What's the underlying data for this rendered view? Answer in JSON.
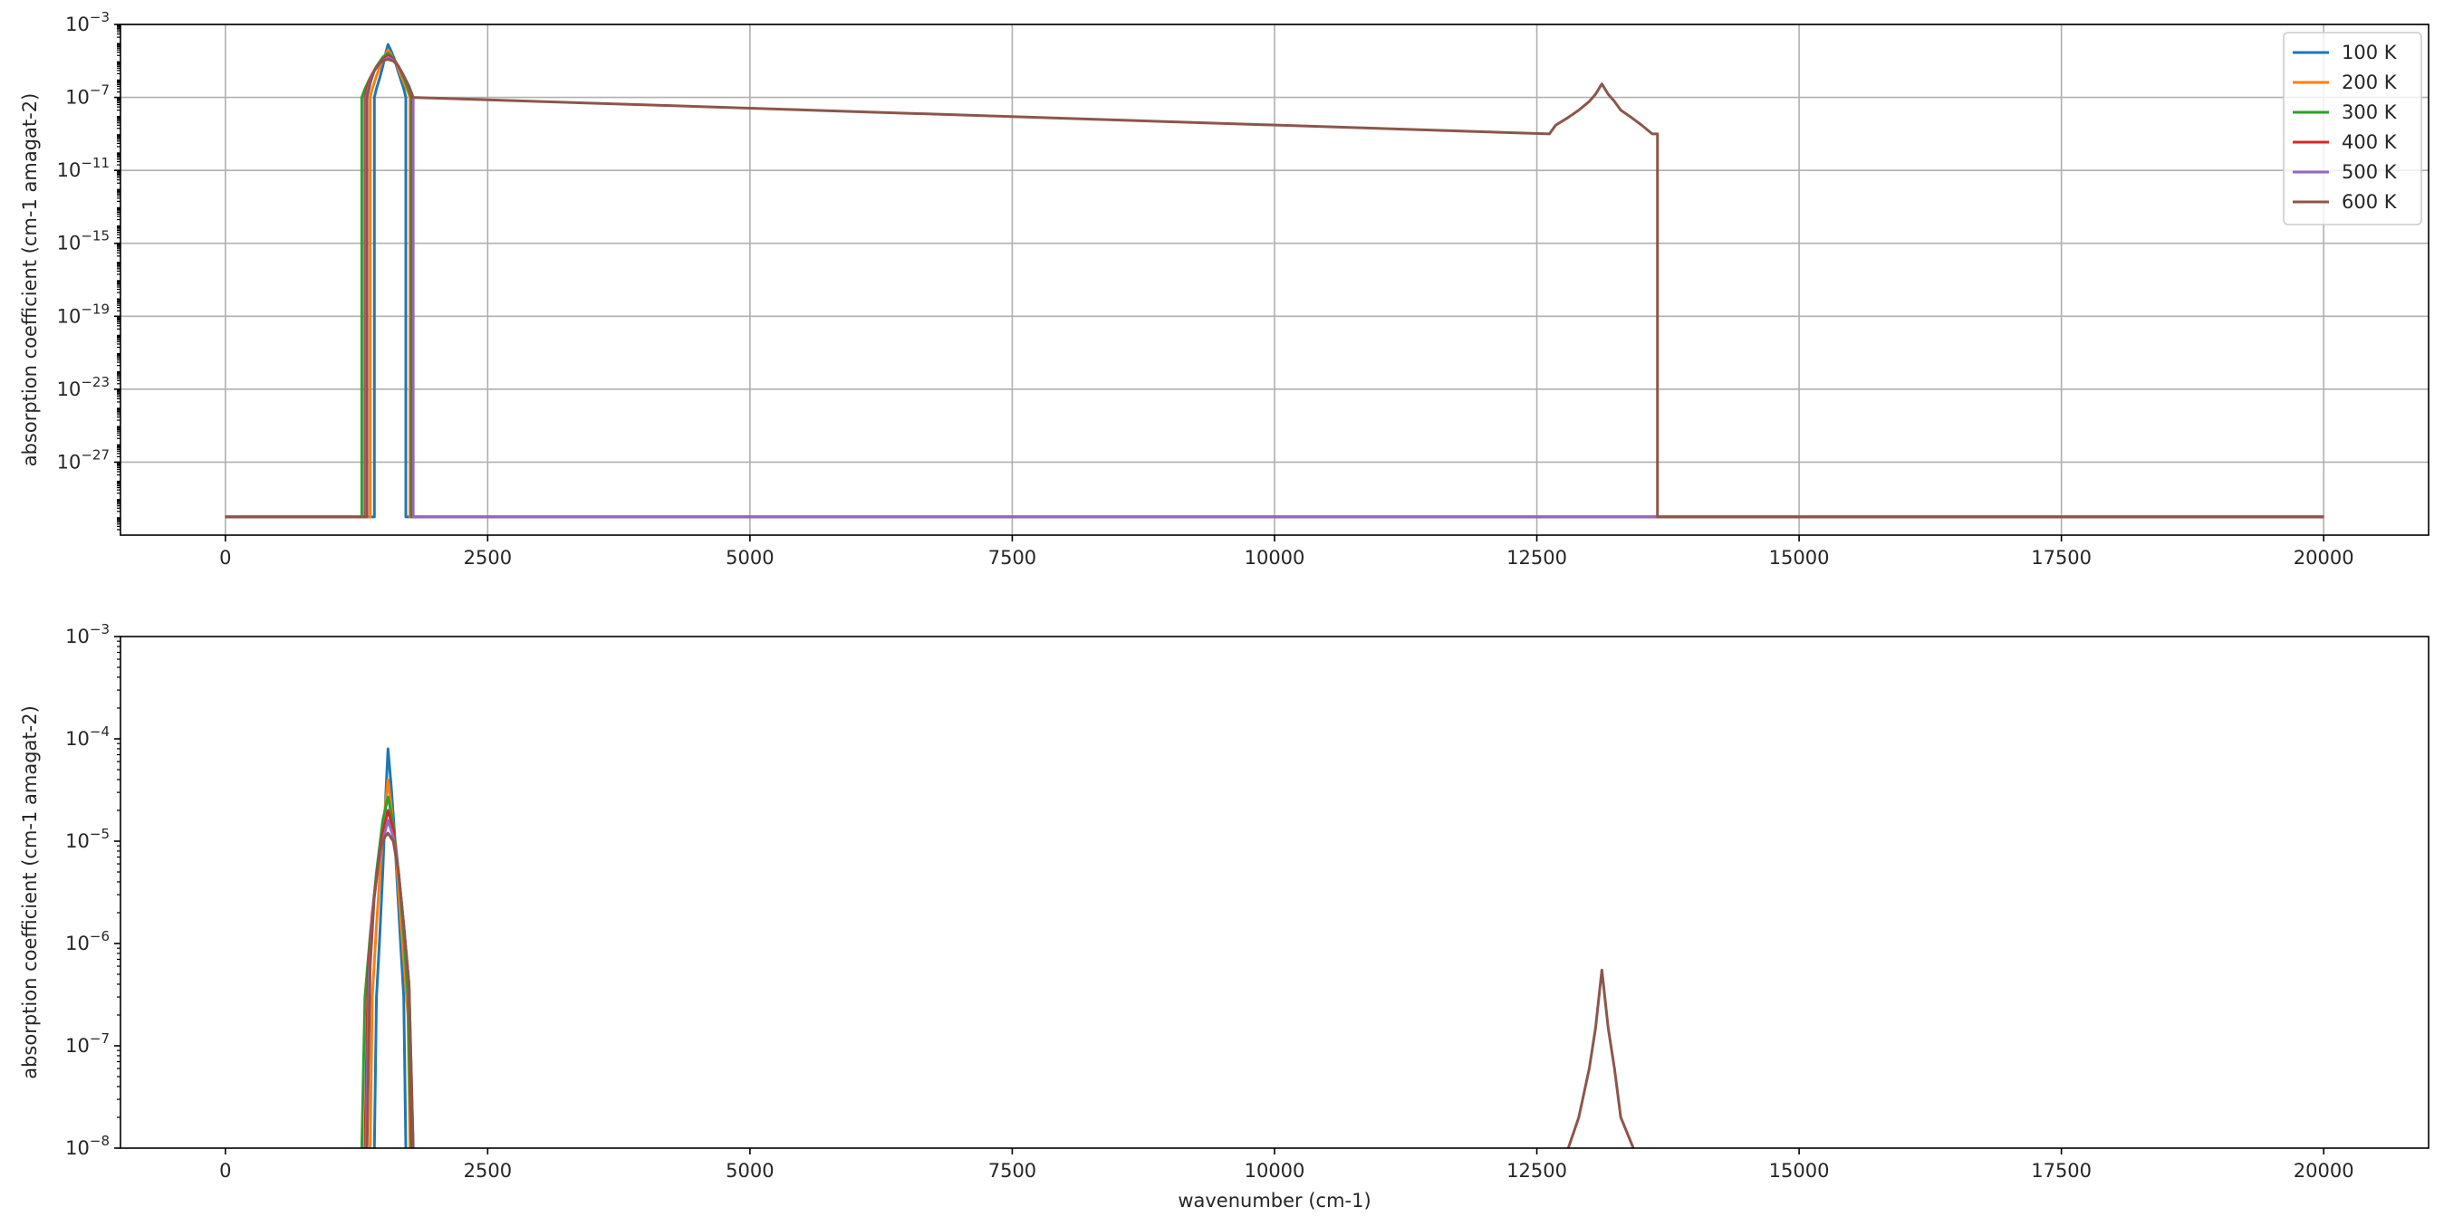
{
  "chart_data": [
    {
      "type": "line",
      "title": "",
      "xlabel": "",
      "ylabel": "absorption coefficient (cm-1 amagat-2)",
      "yscale": "log",
      "xlim": [
        -1000,
        21000
      ],
      "ylim": [
        1e-31,
        0.001
      ],
      "xticks": [
        0,
        2500,
        5000,
        7500,
        10000,
        12500,
        15000,
        17500,
        20000
      ],
      "yticks": [
        1e-27,
        1e-23,
        1e-19,
        1e-15,
        1e-11,
        1e-07,
        0.001
      ],
      "ytick_exponents": [
        "−27",
        "−23",
        "−19",
        "−15",
        "−11",
        "−7",
        "−3"
      ],
      "grid": true,
      "legend": "top-right",
      "floor_value": 1e-30,
      "series": [
        {
          "name": "100 K",
          "color": "#1f77b4",
          "x": [
            1420,
            1440,
            1470,
            1500,
            1530,
            1550,
            1580,
            1610,
            1640,
            1670,
            1700,
            1720
          ],
          "y": [
            1e-07,
            3e-07,
            1.1e-06,
            5e-06,
            3e-05,
            8e-05,
            3.5e-05,
            1.3e-05,
            3.5e-06,
            1e-06,
            3e-07,
            1e-07
          ]
        },
        {
          "name": "200 K",
          "color": "#ff7f0e",
          "x": [
            1380,
            1400,
            1440,
            1480,
            1520,
            1550,
            1580,
            1620,
            1660,
            1700,
            1740,
            1760
          ],
          "y": [
            1e-07,
            3e-07,
            1.5e-06,
            6e-06,
            2e-05,
            4e-05,
            2.2e-05,
            9e-06,
            2.5e-06,
            7e-07,
            2e-07,
            1e-07
          ]
        },
        {
          "name": "300 K",
          "color": "#2ca02c",
          "x": [
            1300,
            1330,
            1380,
            1440,
            1500,
            1550,
            1600,
            1650,
            1700,
            1740,
            1770
          ],
          "y": [
            1e-07,
            3e-07,
            1.2e-06,
            5e-06,
            1.6e-05,
            2.7e-05,
            1.5e-05,
            5e-06,
            1.2e-06,
            3e-07,
            1e-07
          ]
        },
        {
          "name": "400 K",
          "color": "#d62728",
          "x": [
            1330,
            1360,
            1400,
            1450,
            1500,
            1550,
            1600,
            1650,
            1700,
            1750,
            1780
          ],
          "y": [
            1e-07,
            5e-07,
            2e-06,
            5e-06,
            1.2e-05,
            2e-05,
            1.3e-05,
            5e-06,
            1.5e-06,
            4e-07,
            1e-07
          ]
        },
        {
          "name": "500 K",
          "color": "#9467bd",
          "x": [
            1340,
            1370,
            1410,
            1460,
            1510,
            1550,
            1600,
            1650,
            1700,
            1750,
            1790
          ],
          "y": [
            1e-07,
            5e-07,
            2.5e-06,
            6e-06,
            1.1e-05,
            1.6e-05,
            1.1e-05,
            5e-06,
            1.5e-06,
            4e-07,
            1e-07
          ]
        },
        {
          "name": "600 K",
          "color": "#8c564b",
          "x": [
            1350,
            1380,
            1420,
            1470,
            1520,
            1550,
            1600,
            1650,
            1700,
            1750,
            1790,
            12620,
            12680,
            12800,
            12900,
            13000,
            13060,
            13120,
            13180,
            13240,
            13300,
            13400,
            13500,
            13600,
            13650
          ],
          "y": [
            1e-07,
            6e-07,
            3e-06,
            8e-06,
            1.1e-05,
            1.2e-05,
            1e-05,
            5e-06,
            1.5e-06,
            4e-07,
            1e-07,
            1e-09,
            3e-09,
            8e-09,
            2e-08,
            6e-08,
            1.5e-07,
            5.5e-07,
            1.5e-07,
            6e-08,
            2e-08,
            8e-09,
            3e-09,
            1e-09,
            1e-09
          ]
        }
      ]
    },
    {
      "type": "line",
      "title": "",
      "xlabel": "wavenumber (cm-1)",
      "ylabel": "absorption coefficient (cm-1 amagat-2)",
      "yscale": "log",
      "xlim": [
        -1000,
        21000
      ],
      "ylim": [
        1e-08,
        0.001
      ],
      "xticks": [
        0,
        2500,
        5000,
        7500,
        10000,
        12500,
        15000,
        17500,
        20000
      ],
      "yticks": [
        1e-08,
        1e-07,
        1e-06,
        1e-05,
        0.0001,
        0.001
      ],
      "ytick_exponents": [
        "−8",
        "−7",
        "−6",
        "−5",
        "−4",
        "−3"
      ],
      "grid": false,
      "legend": "none",
      "series": [
        {
          "name": "100 K",
          "color": "#1f77b4",
          "x": [
            1420,
            1440,
            1470,
            1500,
            1530,
            1550,
            1580,
            1610,
            1640,
            1670,
            1700,
            1720
          ],
          "y": [
            1e-08,
            3e-07,
            1.1e-06,
            5e-06,
            3e-05,
            8e-05,
            3.5e-05,
            1.3e-05,
            3.5e-06,
            1e-06,
            3e-07,
            1e-08
          ]
        },
        {
          "name": "200 K",
          "color": "#ff7f0e",
          "x": [
            1380,
            1400,
            1440,
            1480,
            1520,
            1550,
            1580,
            1620,
            1660,
            1700,
            1740,
            1760
          ],
          "y": [
            1e-08,
            3e-07,
            1.5e-06,
            6e-06,
            2e-05,
            4e-05,
            2.2e-05,
            9e-06,
            2.5e-06,
            7e-07,
            2e-07,
            1e-08
          ]
        },
        {
          "name": "300 K",
          "color": "#2ca02c",
          "x": [
            1300,
            1330,
            1380,
            1440,
            1500,
            1550,
            1600,
            1650,
            1700,
            1740,
            1770
          ],
          "y": [
            1e-08,
            3e-07,
            1.2e-06,
            5e-06,
            1.6e-05,
            2.7e-05,
            1.5e-05,
            5e-06,
            1.2e-06,
            3e-07,
            1e-08
          ]
        },
        {
          "name": "400 K",
          "color": "#d62728",
          "x": [
            1330,
            1360,
            1400,
            1450,
            1500,
            1550,
            1600,
            1650,
            1700,
            1750,
            1780
          ],
          "y": [
            1e-08,
            5e-07,
            2e-06,
            5e-06,
            1.2e-05,
            2e-05,
            1.3e-05,
            5e-06,
            1.5e-06,
            4e-07,
            1e-08
          ]
        },
        {
          "name": "500 K",
          "color": "#9467bd",
          "x": [
            1340,
            1370,
            1410,
            1460,
            1510,
            1550,
            1600,
            1650,
            1700,
            1750,
            1790
          ],
          "y": [
            1e-08,
            5e-07,
            2.5e-06,
            6e-06,
            1.1e-05,
            1.6e-05,
            1.1e-05,
            5e-06,
            1.5e-06,
            4e-07,
            1e-08
          ]
        },
        {
          "name": "600 K",
          "color": "#8c564b",
          "x": [
            1350,
            1380,
            1420,
            1470,
            1520,
            1550,
            1600,
            1650,
            1700,
            1750,
            1790,
            null,
            12800,
            12900,
            13000,
            13060,
            13120,
            13180,
            13240,
            13300,
            13420
          ],
          "y": [
            1e-08,
            6e-07,
            3e-06,
            8e-06,
            1.1e-05,
            1.2e-05,
            1e-05,
            5e-06,
            1.5e-06,
            4e-07,
            1e-08,
            null,
            1e-08,
            2e-08,
            6e-08,
            1.5e-07,
            5.5e-07,
            1.5e-07,
            6e-08,
            2e-08,
            1e-08
          ]
        }
      ]
    }
  ]
}
